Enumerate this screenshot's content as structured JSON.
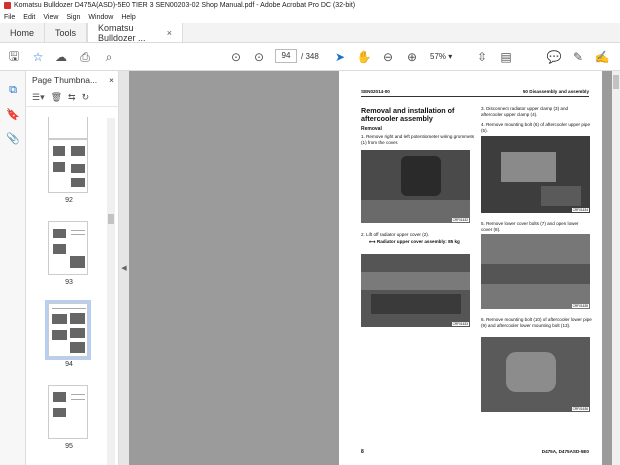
{
  "window": {
    "title": "Komatsu Bulldozer D475A(ASD)-5E0 TIER 3 SEN00203-02 Shop Manual.pdf - Adobe Acrobat Pro DC (32-bit)"
  },
  "menu": [
    "File",
    "Edit",
    "View",
    "Sign",
    "Window",
    "Help"
  ],
  "tabs": {
    "home": "Home",
    "tools": "Tools",
    "document": "Komatsu Bulldozer ..."
  },
  "toolbar": {
    "page_current": "94",
    "page_total": "/ 348",
    "zoom": "57%"
  },
  "thumbnails": {
    "title": "Page Thumbna...",
    "pages": [
      "92",
      "93",
      "94",
      "95"
    ],
    "selected": "94"
  },
  "page": {
    "doc_id": "SEN02014-00",
    "section": "50 Disassembly and assembly",
    "title": "Removal and installation of aftercooler assembly",
    "removal_heading": "Removal",
    "step1": "1.  Remove right and left potentiometer wiring grommets (1) from the cover.",
    "step2": "2.  Lift off radiator upper cover (2).",
    "step2_note": "Radiator upper cover assembly: 85 kg",
    "step3": "3.  Disconnect radiator upper clamp (3) and aftercooler upper clamp (4).",
    "step4": "4.  Remove mounting bolt (6) of aftercooler upper pipe (5).",
    "step5": "5.  Remove lower cover bolts (7) and open lower cover (8).",
    "step6": "6.  Remove mounting bolt (10) of aftercooler lower pipe (9) and aftercooler lower mounting bolt (13).",
    "photo_tags": [
      "CRF01632",
      "CRF01633",
      "CRF01634",
      "CRF01635",
      "CRF01636"
    ],
    "footer_left": "8",
    "footer_right": "D475A, D475ASD-5E0"
  }
}
